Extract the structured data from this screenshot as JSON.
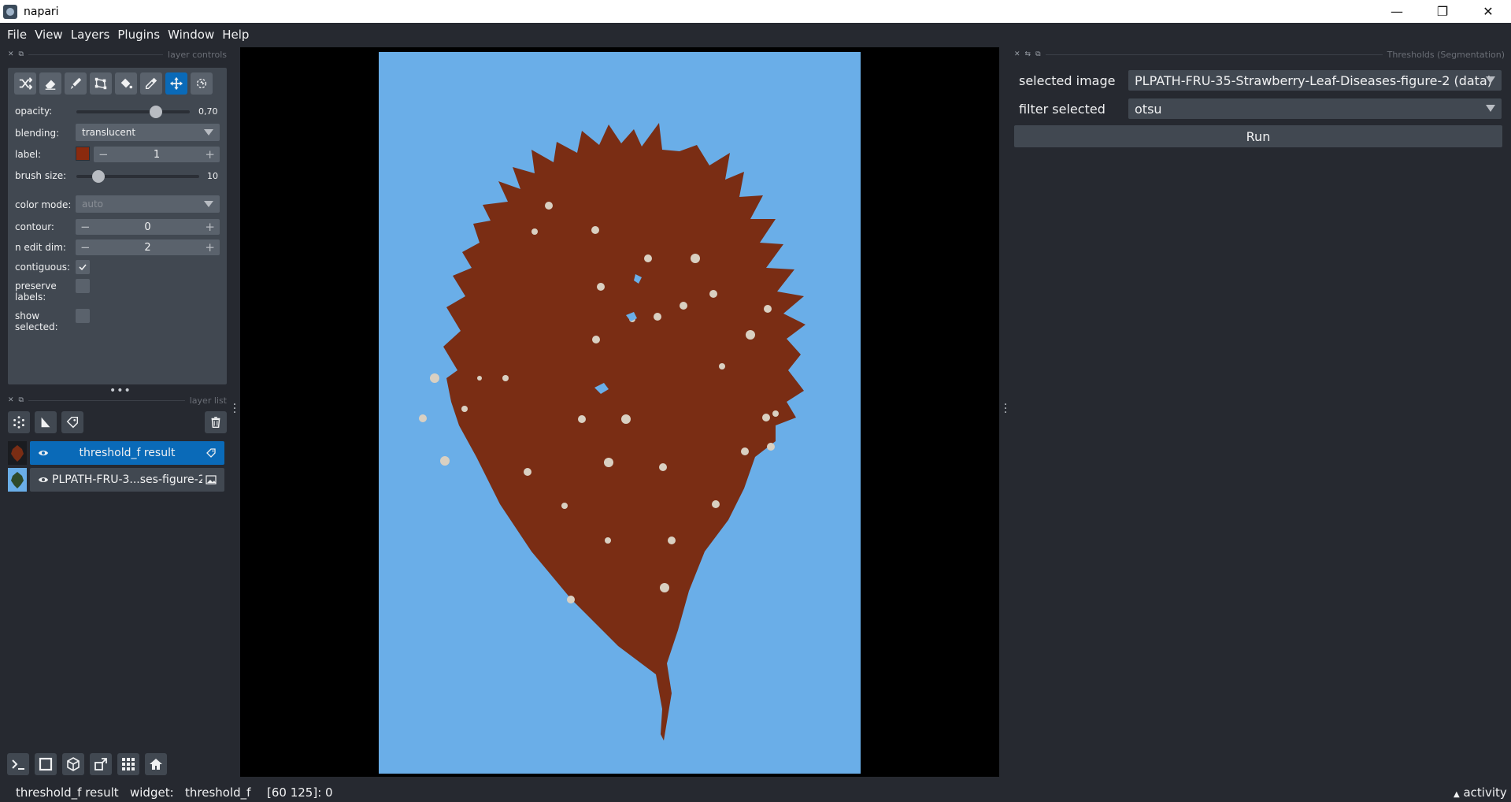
{
  "window": {
    "title": "napari",
    "controls": [
      "—",
      "❐",
      "✕"
    ]
  },
  "menu": [
    "File",
    "View",
    "Layers",
    "Plugins",
    "Window",
    "Help"
  ],
  "layer_controls": {
    "header": "layer controls",
    "opacity": {
      "label": "opacity:",
      "value": "0,70",
      "fraction": 0.7
    },
    "blending": {
      "label": "blending:",
      "value": "translucent"
    },
    "label": {
      "label": "label:",
      "value": "1",
      "color": "#8a2a0e"
    },
    "brush_size": {
      "label": "brush size:",
      "value": "10",
      "fraction": 0.18
    },
    "color_mode": {
      "label": "color mode:",
      "value": "auto"
    },
    "contour": {
      "label": "contour:",
      "value": "0"
    },
    "n_edit_dim": {
      "label": "n edit dim:",
      "value": "2"
    },
    "contiguous": {
      "label": "contiguous:",
      "checked": true
    },
    "preserve_labels": {
      "label": "preserve\nlabels:",
      "checked": false
    },
    "show_selected": {
      "label": "show\nselected:",
      "checked": false
    }
  },
  "layer_list": {
    "header": "layer list",
    "layers": [
      {
        "name": "threshold_f result",
        "type": "labels",
        "selected": true
      },
      {
        "name": "PLPATH-FRU-3...ses-figure-2",
        "type": "image",
        "selected": false
      }
    ]
  },
  "plugin": {
    "header": "Thresholds (Segmentation)",
    "selected_image_label": "selected image",
    "selected_image_value": "PLPATH-FRU-35-Strawberry-Leaf-Diseases-figure-2 (data)",
    "filter_label": "filter selected",
    "filter_value": "otsu",
    "run_label": "Run"
  },
  "status": {
    "layer": "threshold_f result",
    "widget_label": "widget:",
    "widget_value": "threshold_f",
    "coords": "[60 125]: 0",
    "activity": "activity"
  },
  "colors": {
    "background": "#262930",
    "panel": "#414851",
    "accent": "#0a6ab8",
    "leaf": "#7a2d14",
    "canvas_image": "#6aaee8"
  }
}
